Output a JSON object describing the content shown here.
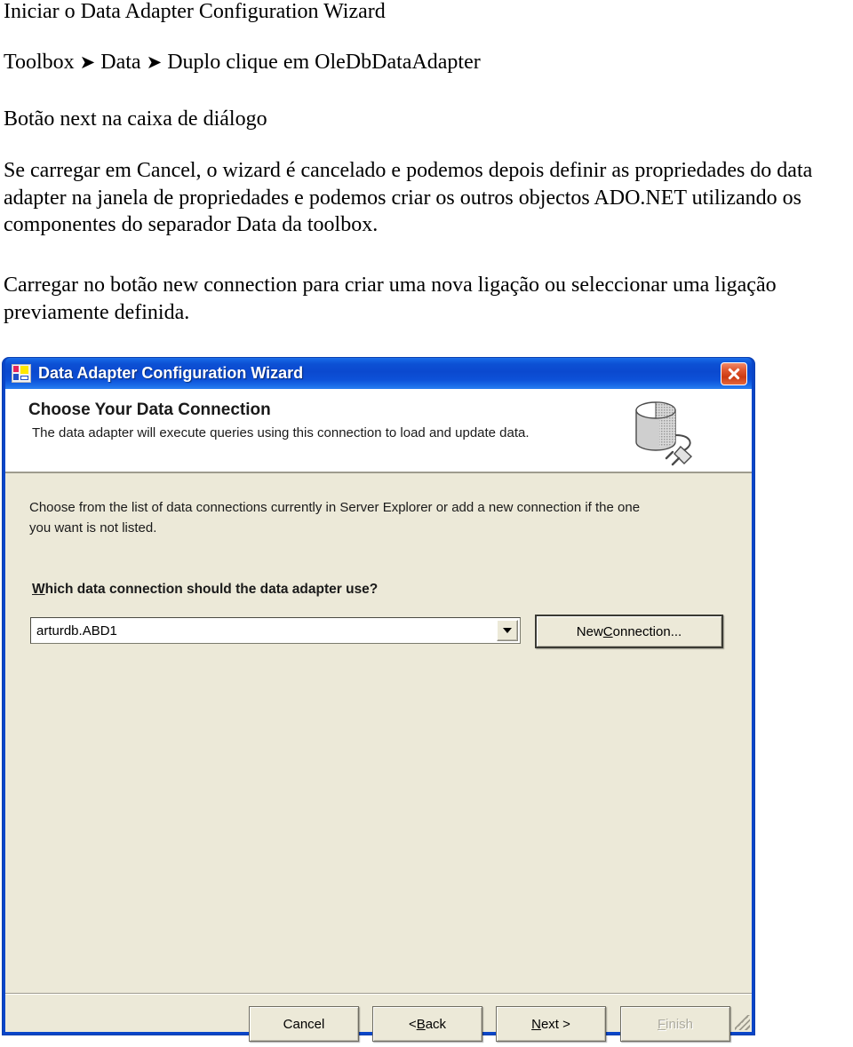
{
  "document": {
    "title": "Iniciar o Data Adapter Configuration Wizard",
    "breadcrumb_line": "Toolbox ➔ Data ➔ Duplo clique em OleDbDataAdapter",
    "breadcrumb_parts": [
      "Toolbox",
      "Data",
      "Duplo clique em OleDbDataAdapter"
    ],
    "step_line": "Botão next na caixa de diálogo",
    "paragraph_1": "Se carregar em Cancel, o wizard é cancelado e podemos depois definir as propriedades do data adapter na janela de propriedades e podemos criar os outros objectos ADO.NET utilizando os componentes do separador Data da toolbox.",
    "paragraph_2": "Carregar no botão new connection para criar uma nova ligação ou seleccionar uma ligação previamente definida."
  },
  "dialog": {
    "title": "Data Adapter Configuration Wizard",
    "window_icon": "visual-studio-icon",
    "close_label": "✕",
    "header": {
      "heading": "Choose Your Data Connection",
      "description": "The data adapter will execute queries using this connection to load and update data.",
      "artwork": "database-with-plug-icon"
    },
    "body": {
      "description": "Choose from the list of data connections currently in Server Explorer or add a new connection if the one you want is not listed.",
      "field_label_accel": "W",
      "field_label_rest": "hich data connection should the data adapter use?",
      "connection_value": "arturdb.ABD1",
      "new_connection": {
        "before": "New ",
        "accel": "C",
        "after": "onnection..."
      }
    },
    "footer": {
      "cancel": "Cancel",
      "back_before": "< ",
      "back_accel": "B",
      "back_after": "ack",
      "next_accel": "N",
      "next_after": "ext >",
      "finish_accel": "F",
      "finish_after": "inish",
      "finish_enabled": false
    }
  },
  "colors": {
    "titlebar_blue": "#0b49cf",
    "window_frame": "#0a46c8",
    "dialog_face": "#ece9d8",
    "header_white": "#ffffff",
    "close_red": "#cc3a12",
    "disabled_text": "#acaa9e"
  }
}
